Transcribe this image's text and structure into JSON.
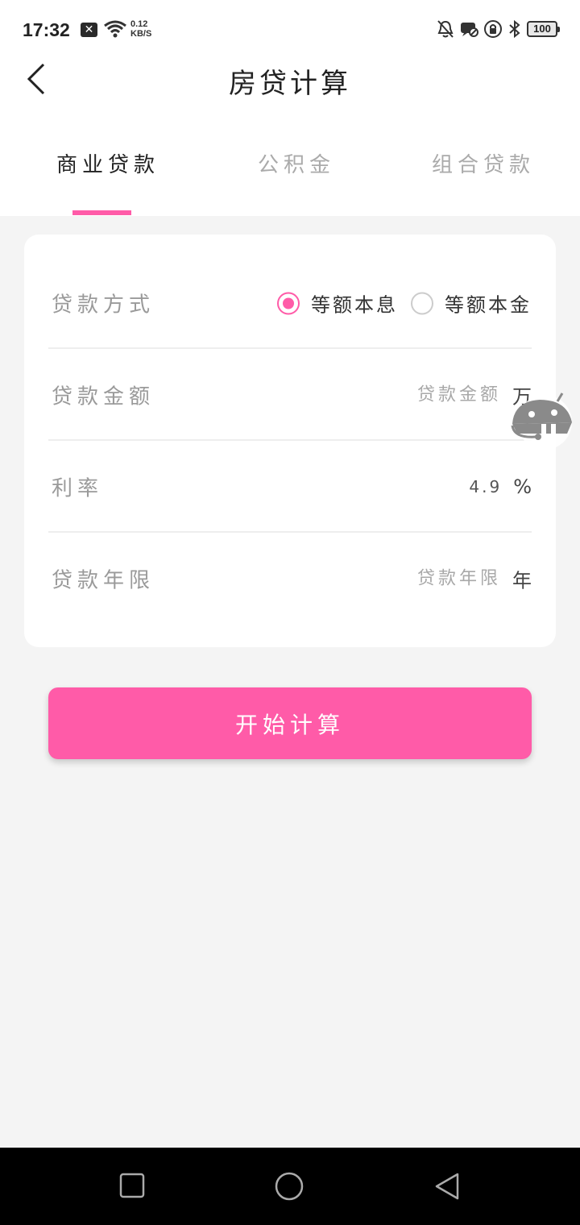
{
  "status_bar": {
    "time": "17:32",
    "x_badge": "✕",
    "net_speed_value": "0.12",
    "net_speed_unit": "KB/S",
    "battery": "100"
  },
  "header": {
    "title": "房贷计算"
  },
  "tabs": [
    {
      "label": "商业贷款",
      "active": true
    },
    {
      "label": "公积金",
      "active": false
    },
    {
      "label": "组合贷款",
      "active": false
    }
  ],
  "form": {
    "method": {
      "label": "贷款方式",
      "options": [
        {
          "label": "等额本息",
          "selected": true
        },
        {
          "label": "等额本金",
          "selected": false
        }
      ]
    },
    "amount": {
      "label": "贷款金额",
      "placeholder": "贷款金额",
      "unit": "万"
    },
    "rate": {
      "label": "利率",
      "value": "4.9",
      "unit": "%"
    },
    "years": {
      "label": "贷款年限",
      "placeholder": "贷款年限",
      "unit": "年"
    }
  },
  "calc_button": {
    "label": "开始计算"
  },
  "colors": {
    "accent": "#ff5ba8",
    "background": "#f4f4f4",
    "card": "#ffffff"
  },
  "icons": {
    "back": "back-arrow-icon",
    "robot": "robot-assistant-icon",
    "wifi": "wifi-icon",
    "bell_off": "bell-off-icon",
    "bluetooth": "bluetooth-icon"
  }
}
